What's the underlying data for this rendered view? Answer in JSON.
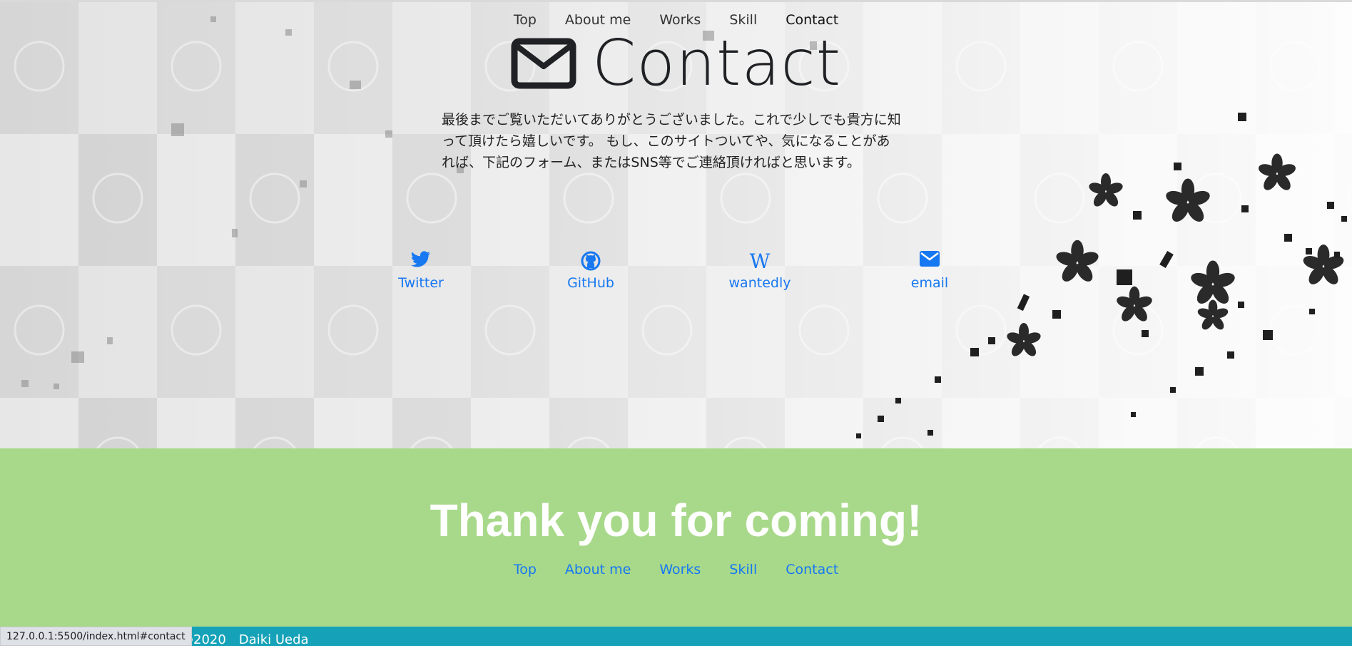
{
  "nav": {
    "items": [
      {
        "label": "Top"
      },
      {
        "label": "About me"
      },
      {
        "label": "Works"
      },
      {
        "label": "Skill"
      },
      {
        "label": "Contact"
      }
    ]
  },
  "contact": {
    "icon": "envelope-icon",
    "title": "Contact",
    "intro": "最後までご覧いただいてありがとうございました。これで少しでも貴方に知って頂けたら嬉しいです。 もし、このサイトついてや、気になることがあれば、下記のフォーム、またはSNS等でご連絡頂ければと思います。"
  },
  "social": [
    {
      "label": "Twitter",
      "icon": "twitter-icon"
    },
    {
      "label": "GitHub",
      "icon": "github-icon"
    },
    {
      "label": "wantedly",
      "icon": "wikipedia-w-icon"
    },
    {
      "label": "email",
      "icon": "envelope-icon"
    }
  ],
  "footer": {
    "thanks": "Thank you for coming!",
    "copyright": "@2020　Daiki Ueda"
  },
  "status_bar": {
    "url": "127.0.0.1:5500/index.html#contact"
  },
  "colors": {
    "link": "#1778f2",
    "footer_bg": "#a8d98a",
    "copyright_bar": "#15a2b8",
    "title": "#1f2124"
  }
}
